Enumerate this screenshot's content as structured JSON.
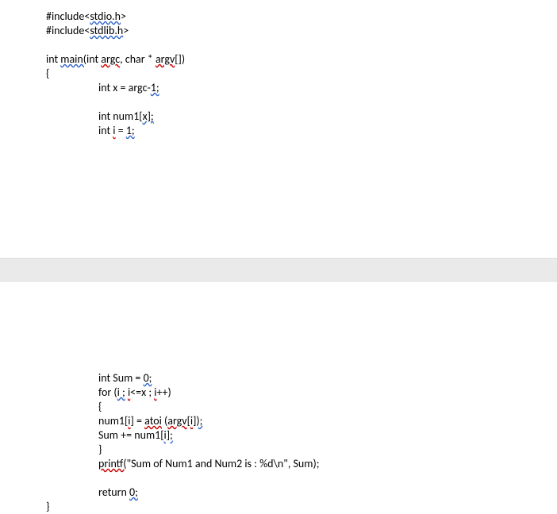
{
  "code": {
    "line1_a": "#include<",
    "line1_b": "stdio.h",
    "line1_c": ">",
    "line2_a": "#include<",
    "line2_b": "stdlib.h",
    "line2_c": ">",
    "line3_a": "int ",
    "line3_b": "main(",
    "line3_c": "int ",
    "line3_d": "argc",
    "line3_e": ", char * ",
    "line3_f": "argv",
    "line3_g": "[])",
    "line4": "{",
    "line5_a": "int x = argc-",
    "line5_b": "1;",
    "line6_a": "int num1[",
    "line6_b": "x];",
    "line7_a": "int ",
    "line7_b": "i",
    "line7_c": " = ",
    "line7_d": "1;",
    "line8_a": "int Sum = ",
    "line8_b": "0;",
    "line9_a": "for (",
    "line9_b": "i ;",
    "line9_c": " ",
    "line9_d": "i",
    "line9_e": "<=x ; ",
    "line9_f": "i",
    "line9_g": "++)",
    "line10": "{",
    "line11_a": "num1[",
    "line11_b": "i",
    "line11_c": "] = ",
    "line11_d": "atoi",
    "line11_e": " (",
    "line11_f": "argv",
    "line11_g": "[",
    "line11_h": "i",
    "line11_i": "]);",
    "line12_a": "Sum += num1[",
    "line12_b": "i];",
    "line13": "}",
    "line14_a": "printf(",
    "line14_b": "\"Sum of Num1 and Num2 is : %d\\n\", Sum);",
    "line15_a": "return ",
    "line15_b": "0;",
    "line16": "}"
  }
}
